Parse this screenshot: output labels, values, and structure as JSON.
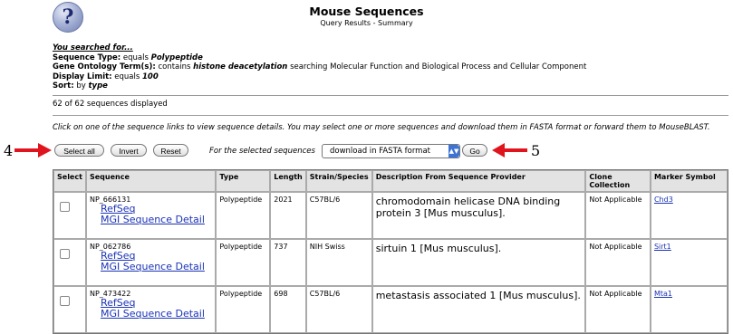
{
  "header": {
    "title": "Mouse Sequences",
    "subtitle": "Query Results - Summary",
    "help_glyph": "?"
  },
  "search": {
    "heading": "You searched for...",
    "seq_type_label": "Sequence Type:",
    "seq_type_op": "equals",
    "seq_type_value": "Polypeptide",
    "go_label": "Gene Ontology Term(s):",
    "go_op": "contains",
    "go_value": "histone deacetylation",
    "go_rest": "searching Molecular Function and Biological Process and Cellular Component",
    "limit_label": "Display Limit:",
    "limit_op": "equals",
    "limit_value": "100",
    "sort_label": "Sort:",
    "sort_op": "by",
    "sort_value": "type"
  },
  "count_text": "62 of 62 sequences displayed",
  "instructions": "Click on one of the sequence links to view sequence details. You may select one or more sequences and download them in FASTA format or forward them to MouseBLAST.",
  "toolbar": {
    "select_all": "Select all",
    "invert": "Invert",
    "reset": "Reset",
    "for_selected": "For the selected sequences",
    "action_value": "download in FASTA format",
    "go": "Go"
  },
  "annotations": {
    "left_num": "4",
    "right_num": "5",
    "arrow_color": "#e0141c"
  },
  "table": {
    "headers": {
      "select": "Select",
      "sequence": "Sequence",
      "type": "Type",
      "length": "Length",
      "strain": "Strain/Species",
      "desc": "Description From Sequence Provider",
      "clone": "Clone Collection",
      "marker": "Marker Symbol"
    },
    "rows": [
      {
        "id": "NP_666131",
        "link1": "RefSeq",
        "link2": "MGI Sequence Detail",
        "type": "Polypeptide",
        "length": "2021",
        "strain": "C57BL/6",
        "desc": "chromodomain helicase DNA binding protein 3 [Mus musculus].",
        "clone": "Not Applicable",
        "marker": "Chd3"
      },
      {
        "id": "NP_062786",
        "link1": "RefSeq",
        "link2": "MGI Sequence Detail",
        "type": "Polypeptide",
        "length": "737",
        "strain": "NIH Swiss",
        "desc": "sirtuin 1 [Mus musculus].",
        "clone": "Not Applicable",
        "marker": "Sirt1"
      },
      {
        "id": "NP_473422",
        "link1": "RefSeq",
        "link2": "MGI Sequence Detail",
        "type": "Polypeptide",
        "length": "698",
        "strain": "C57BL/6",
        "desc": "metastasis associated 1 [Mus musculus].",
        "clone": "Not Applicable",
        "marker": "Mta1"
      }
    ]
  }
}
